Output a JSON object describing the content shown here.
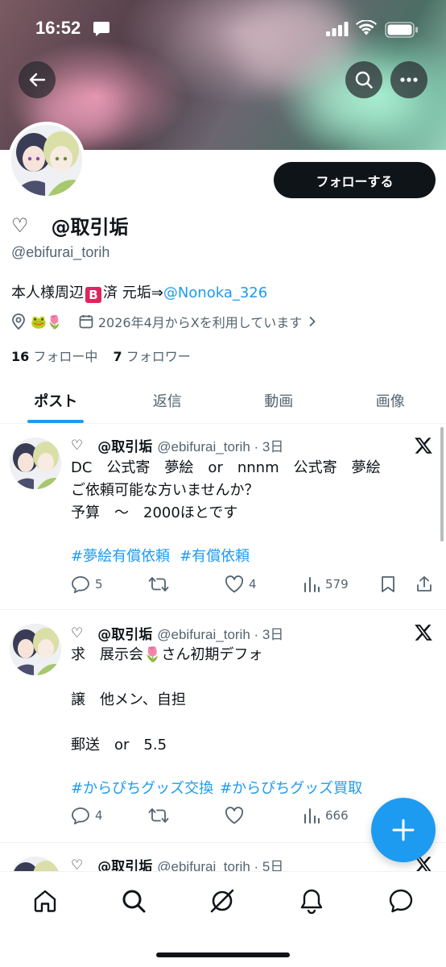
{
  "status_bar": {
    "time": "16:52"
  },
  "profile": {
    "display_name_symbol": "♡",
    "display_name": "@取引垢",
    "handle": "@ebifurai_torih",
    "follow_label": "フォローする",
    "bio_prefix": "本人様周辺",
    "bio_badge": "B",
    "bio_middle": "済 元垢⇒",
    "bio_mention": "@Nonoka_326",
    "location_emoji": "🐸🌷",
    "joined": "2026年4月からXを利用しています",
    "following_count": "16",
    "following_label": "フォロー中",
    "followers_count": "7",
    "followers_label": "フォロワー"
  },
  "tabs": [
    {
      "label": "ポスト",
      "active": true
    },
    {
      "label": "返信",
      "active": false
    },
    {
      "label": "動画",
      "active": false
    },
    {
      "label": "画像",
      "active": false
    }
  ],
  "tweets": [
    {
      "symbol": "♡",
      "name": "@取引垢",
      "handle_time": "@ebifurai_torih · 3日",
      "text": "DC　公式寄　夢絵　or　nnnm　公式寄　夢絵\nご依頼可能な方いませんか？\n予算　～　2000ほとです",
      "tags": [
        "#夢絵有償依頼",
        "#有償依頼"
      ],
      "replies": "5",
      "reposts": "",
      "likes": "4",
      "views": "579"
    },
    {
      "symbol": "♡",
      "name": "@取引垢",
      "handle_time": "@ebifurai_torih · 3日",
      "text": "求　展示会🌷さん初期デフォ\n\n譲　他メン、自担\n\n郵送　or　5.5",
      "tags": [
        "#からぴちグッズ交換",
        "#からぴちグッズ買取"
      ],
      "replies": "4",
      "reposts": "",
      "likes": "",
      "views": "666"
    },
    {
      "symbol": "♡",
      "name": "@取引垢",
      "handle_time": "@ebifurai_torih · 5日"
    }
  ],
  "colors": {
    "accent": "#1d9bf0",
    "text": "#0f1419",
    "secondary": "#536471"
  }
}
